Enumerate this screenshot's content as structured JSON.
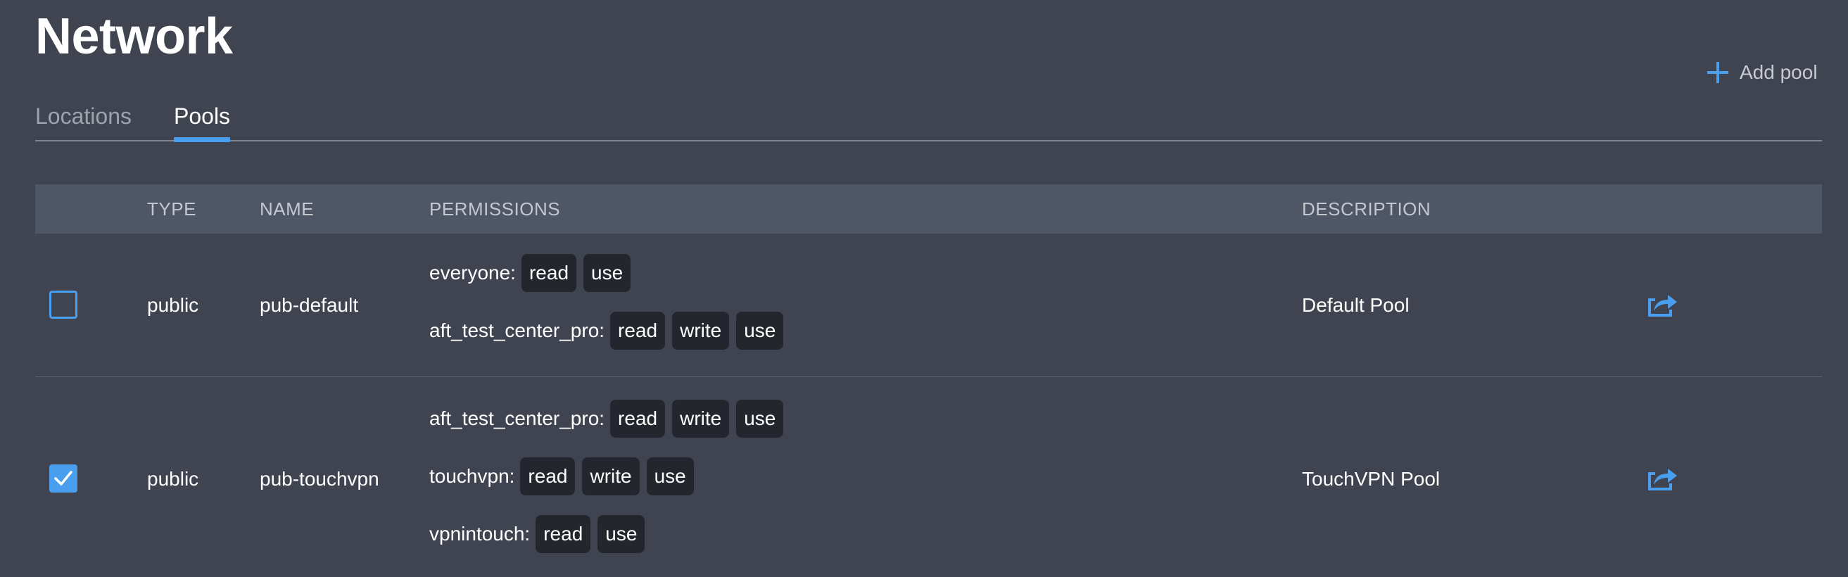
{
  "page": {
    "title": "Network"
  },
  "header": {
    "add_pool_label": "Add pool"
  },
  "tabs": [
    {
      "label": "Locations",
      "active": false
    },
    {
      "label": "Pools",
      "active": true
    }
  ],
  "table": {
    "columns": [
      "TYPE",
      "NAME",
      "PERMISSIONS",
      "DESCRIPTION"
    ],
    "rows": [
      {
        "checked": false,
        "type": "public",
        "name": "pub-default",
        "permissions": [
          {
            "entity": "everyone:",
            "perms": [
              "read",
              "use"
            ]
          },
          {
            "entity": "aft_test_center_pro:",
            "perms": [
              "read",
              "write",
              "use"
            ]
          }
        ],
        "description": "Default Pool",
        "action_icon": "share-icon"
      },
      {
        "checked": true,
        "type": "public",
        "name": "pub-touchvpn",
        "permissions": [
          {
            "entity": "aft_test_center_pro:",
            "perms": [
              "read",
              "write",
              "use"
            ]
          },
          {
            "entity": "touchvpn:",
            "perms": [
              "read",
              "write",
              "use"
            ]
          },
          {
            "entity": "vpnintouch:",
            "perms": [
              "read",
              "use"
            ]
          }
        ],
        "description": "TouchVPN Pool",
        "action_icon": "share-icon"
      }
    ]
  },
  "colors": {
    "background": "#3f4450",
    "accent": "#4a9eee",
    "header_bg": "#4f5666",
    "badge_bg": "#23262c"
  }
}
